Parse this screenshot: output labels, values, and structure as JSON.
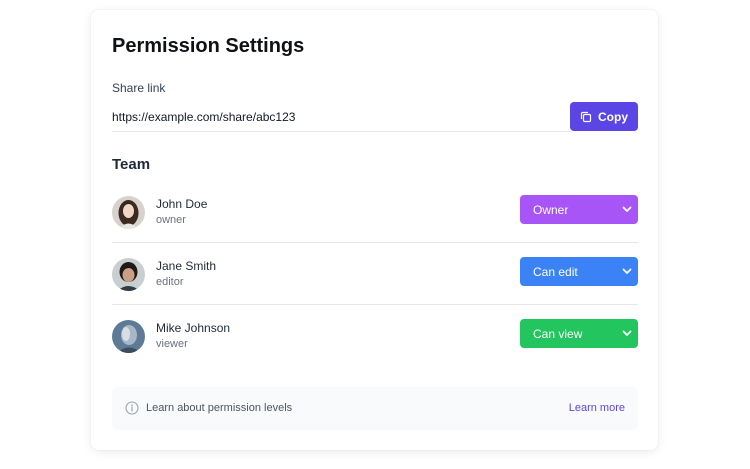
{
  "title": "Permission Settings",
  "share": {
    "label": "Share link",
    "url": "https://example.com/share/abc123",
    "copy_label": "Copy"
  },
  "team": {
    "label": "Team",
    "members": [
      {
        "name": "John Doe",
        "role": "owner",
        "permission": "Owner",
        "permission_color": "#a855f7"
      },
      {
        "name": "Jane Smith",
        "role": "editor",
        "permission": "Can edit",
        "permission_color": "#3b82f6"
      },
      {
        "name": "Mike Johnson",
        "role": "viewer",
        "permission": "Can view",
        "permission_color": "#22c55e"
      }
    ]
  },
  "footer": {
    "text": "Learn about permission levels",
    "link": "Learn more",
    "icon": "info-icon"
  },
  "colors": {
    "accent": "#5b46e5"
  }
}
